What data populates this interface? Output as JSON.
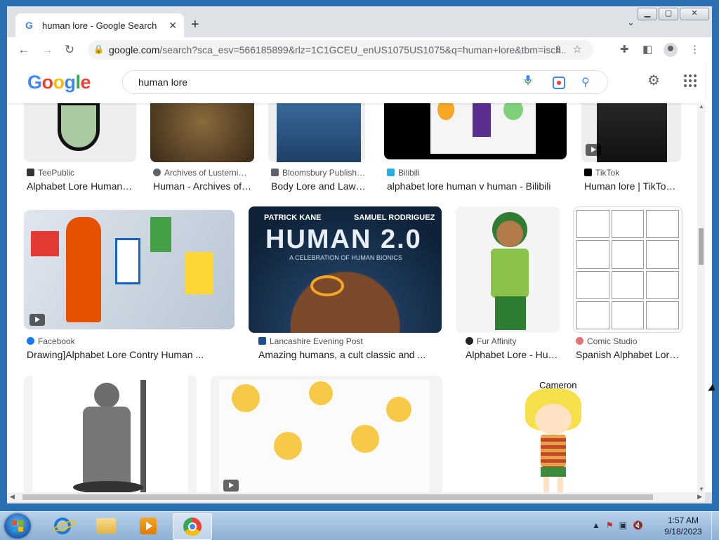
{
  "browser": {
    "tab_title": "human lore - Google Search",
    "url_domain": "google.com",
    "url_path": "/search?sca_esv=566185899&rlz=1C1GCEU_enUS1075US1075&q=human+lore&tbm=isch..."
  },
  "google": {
    "logo_letters": [
      "G",
      "o",
      "o",
      "g",
      "l",
      "e"
    ],
    "search_value": "human lore"
  },
  "results_row1": [
    {
      "source": "TeePublic",
      "caption": "Alphabet Lore Human…",
      "icon_color": "#333333"
    },
    {
      "source": "Archives of Lusterni…",
      "caption": "Human - Archives of…",
      "icon_color": "#5f6368"
    },
    {
      "source": "Bloomsbury Publish…",
      "caption": "Body Lore and Law…",
      "icon_color": "#5f6368"
    },
    {
      "source": "Bilibili",
      "caption": "alphabet lore human v human - Bilibili",
      "icon_color": "#23ade5"
    },
    {
      "source": "TikTok",
      "caption": "Human lore | TikTo…",
      "icon_color": "#000000"
    }
  ],
  "results_row2": [
    {
      "source": "Facebook",
      "caption": "Drawing]Alphabet Lore Contry Human ...",
      "icon_color": "#1877f2"
    },
    {
      "source": "Lancashire Evening Post",
      "caption": "Amazing humans, a cult classic and ...",
      "icon_color": "#1f4e8c",
      "thumb_top": "PATRICK KANE",
      "thumb_top2": "SAMUEL RODRIGUEZ",
      "thumb_title": "HUMAN 2.0",
      "thumb_sub": "A CELEBRATION OF HUMAN BIONICS"
    },
    {
      "source": "Fur Affinity",
      "caption": "Alphabet Lore - Hu…",
      "icon_color": "#222222"
    },
    {
      "source": "Comic Studio",
      "caption": "Spanish Alphabet Lor…",
      "icon_color": "#e57373"
    }
  ],
  "row3_thumb_label": "Cameron",
  "taskbar": {
    "time": "1:57 AM",
    "date": "9/18/2023"
  },
  "colors": {
    "google_blue": "#4285f4",
    "google_red": "#ea4335",
    "google_yellow": "#fbbc05",
    "google_green": "#34a853"
  }
}
